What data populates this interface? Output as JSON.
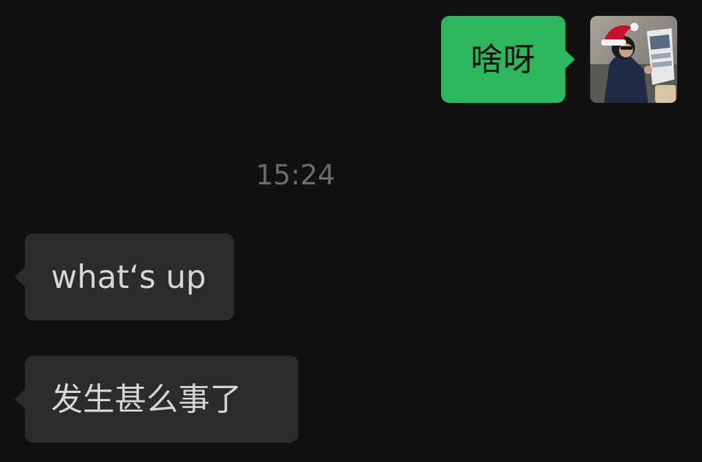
{
  "messages": [
    {
      "direction": "outgoing",
      "text": "啥呀"
    },
    {
      "direction": "timestamp",
      "text": "15:24"
    },
    {
      "direction": "incoming",
      "text": "what‘s up"
    },
    {
      "direction": "incoming",
      "text": "发生甚么事了"
    }
  ],
  "colors": {
    "background": "#111111",
    "outgoing_bubble": "#2cb75f",
    "incoming_bubble": "#2c2c2c",
    "timestamp_text": "#6b6b6b"
  },
  "avatar": {
    "icon": "user-avatar-santa-hat"
  }
}
